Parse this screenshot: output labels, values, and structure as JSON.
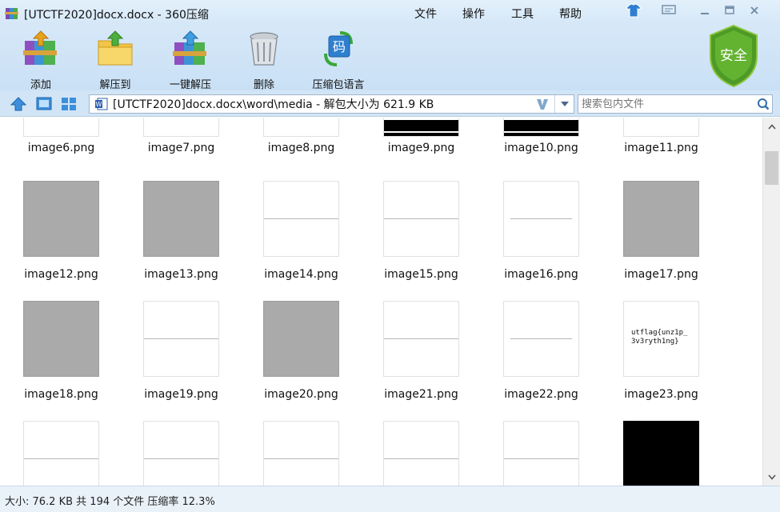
{
  "window": {
    "title": "[UTCTF2020]docx.docx - 360压缩",
    "app_icon": "winrar-books-icon",
    "menu": [
      "文件",
      "操作",
      "工具",
      "帮助"
    ],
    "controls": [
      "skin-shirt-icon",
      "feedback-icon",
      "minimize-icon",
      "maximize-icon",
      "close-icon"
    ]
  },
  "toolbar": {
    "add_label": "添加",
    "extract_to_label": "解压到",
    "one_click_label": "一键解压",
    "delete_label": "删除",
    "language_label": "压缩包语言",
    "language_badge": "码",
    "security_label": "安全",
    "security_color": "#5aa62b"
  },
  "address": {
    "path": "[UTCTF2020]docx.docx\\word\\media - 解包大小为 621.9 KB",
    "search_placeholder": "搜索包内文件"
  },
  "files": [
    {
      "name": "image6.png",
      "thumb": "white"
    },
    {
      "name": "image7.png",
      "thumb": "white"
    },
    {
      "name": "image8.png",
      "thumb": "white"
    },
    {
      "name": "image9.png",
      "thumb": "black-bar"
    },
    {
      "name": "image10.png",
      "thumb": "black-bar"
    },
    {
      "name": "image11.png",
      "thumb": "white"
    },
    {
      "name": "image12.png",
      "thumb": "gray"
    },
    {
      "name": "image13.png",
      "thumb": "gray"
    },
    {
      "name": "image14.png",
      "thumb": "line"
    },
    {
      "name": "image15.png",
      "thumb": "line"
    },
    {
      "name": "image16.png",
      "thumb": "short-line"
    },
    {
      "name": "image17.png",
      "thumb": "gray"
    },
    {
      "name": "image18.png",
      "thumb": "gray"
    },
    {
      "name": "image19.png",
      "thumb": "line"
    },
    {
      "name": "image20.png",
      "thumb": "gray"
    },
    {
      "name": "image21.png",
      "thumb": "line"
    },
    {
      "name": "image22.png",
      "thumb": "short-line"
    },
    {
      "name": "image23.png",
      "thumb": "flag-text",
      "thumb_text": "utflag{unz1p_\n3v3ryth1ng}"
    },
    {
      "name": "",
      "thumb": "line"
    },
    {
      "name": "",
      "thumb": "line"
    },
    {
      "name": "",
      "thumb": "line"
    },
    {
      "name": "",
      "thumb": "line"
    },
    {
      "name": "",
      "thumb": "line"
    },
    {
      "name": "",
      "thumb": "black"
    }
  ],
  "status": {
    "text": "大小: 76.2 KB 共 194 个文件 压缩率 12.3%"
  }
}
